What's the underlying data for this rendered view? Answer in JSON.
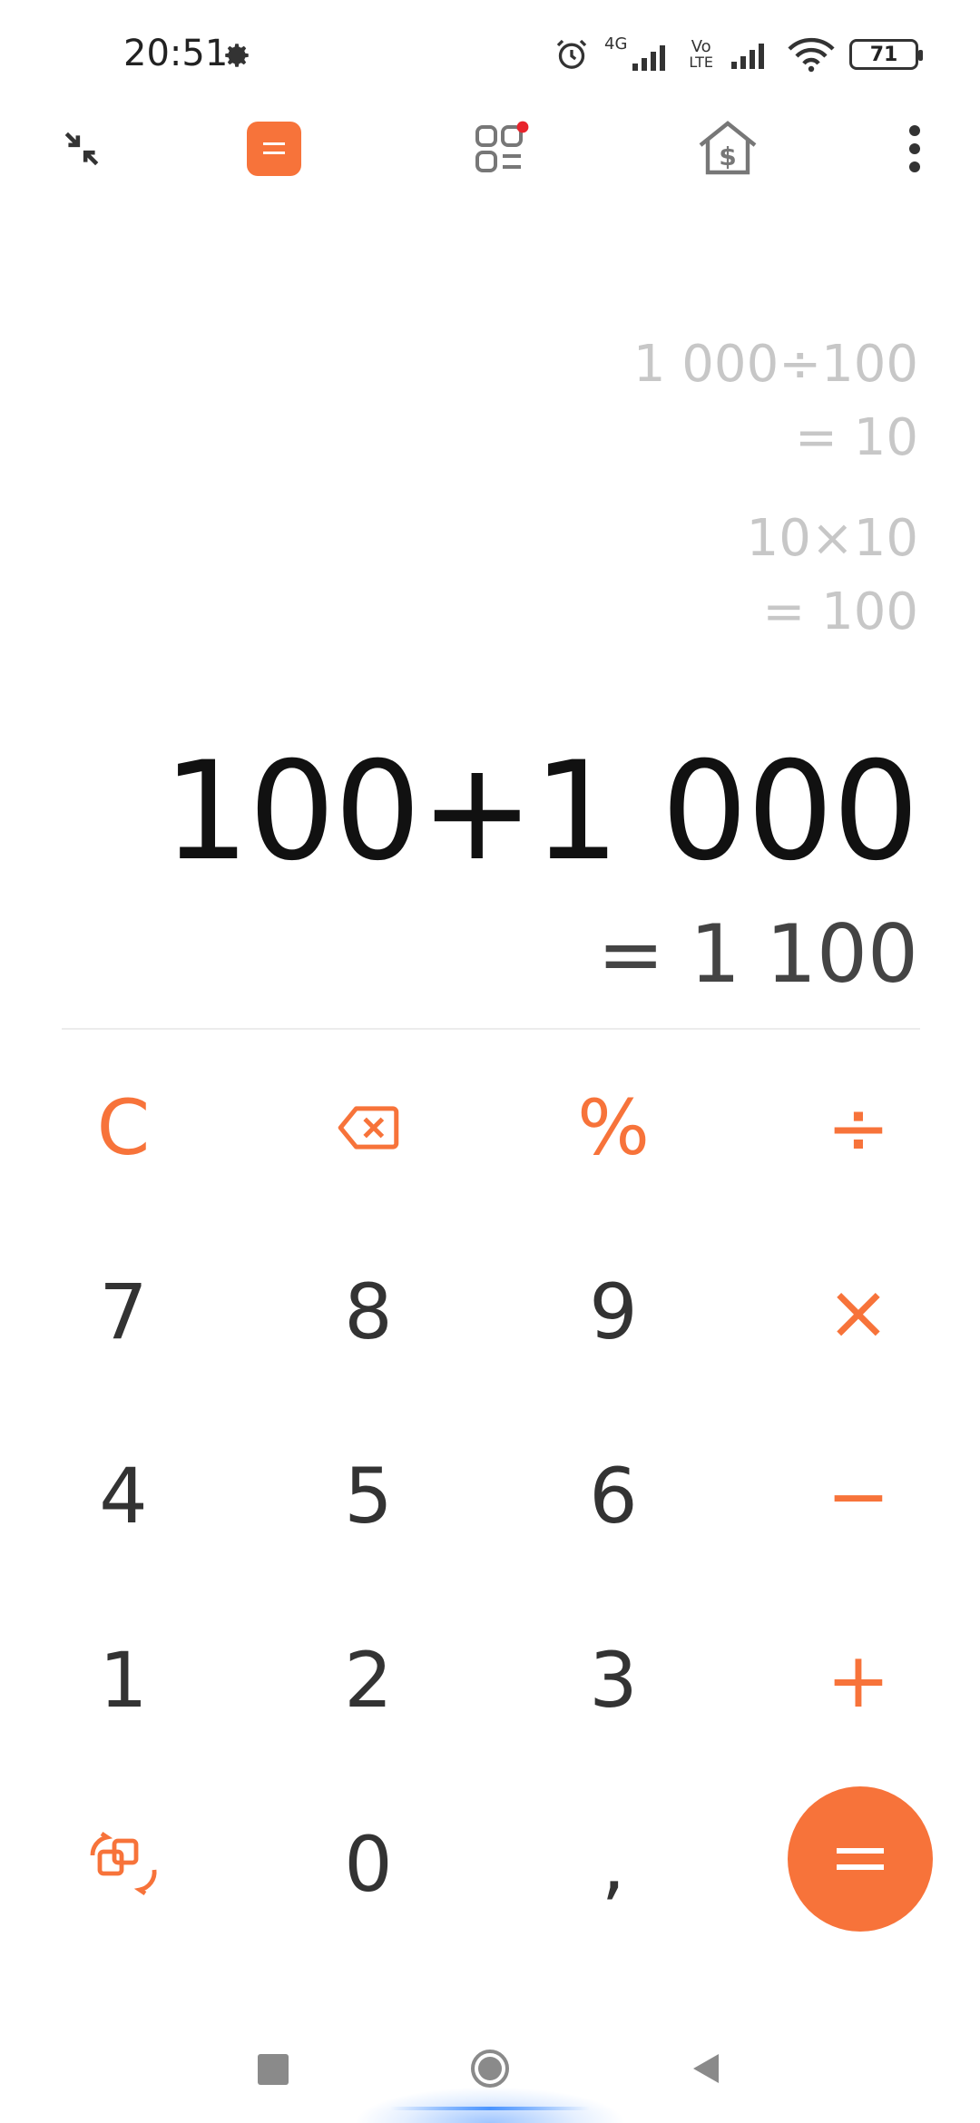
{
  "status_bar": {
    "time": "20:51",
    "network_4g": "4G",
    "volte_top": "Vo",
    "volte_bottom": "LTE",
    "battery": "71"
  },
  "toolbar": {
    "icons": [
      "collapse-icon",
      "calculator-mode-icon",
      "converter-icon",
      "finance-icon",
      "more-icon"
    ],
    "accent_color": "#f7733a",
    "notification_dot_color": "#e8232b"
  },
  "history": [
    {
      "expression": "1 000÷100",
      "result": "= 10"
    },
    {
      "expression": "10×10",
      "result": "= 100"
    }
  ],
  "current": {
    "expression": "100+1 000",
    "result": "= 1 100"
  },
  "keypad": {
    "clear": "C",
    "percent": "%",
    "divide": "÷",
    "multiply": "×",
    "minus": "−",
    "plus": "+",
    "comma": ",",
    "digits": [
      "0",
      "1",
      "2",
      "3",
      "4",
      "5",
      "6",
      "7",
      "8",
      "9"
    ],
    "equals": "="
  }
}
